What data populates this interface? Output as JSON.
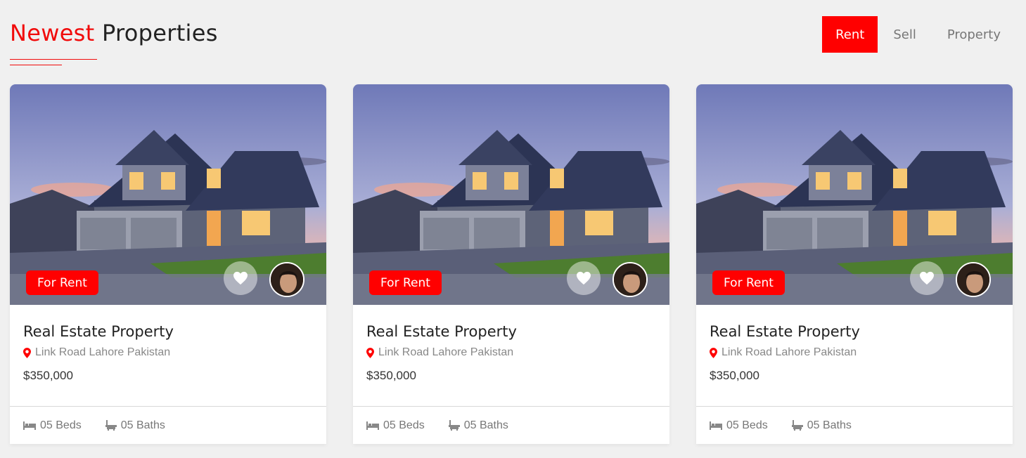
{
  "header": {
    "title_accent": "Newest",
    "title_rest": " Properties",
    "tabs": [
      {
        "label": "Rent",
        "active": true
      },
      {
        "label": "Sell",
        "active": false
      },
      {
        "label": "Property",
        "active": false
      }
    ]
  },
  "colors": {
    "accent": "#ff0000",
    "text": "#222222",
    "muted": "#888888"
  },
  "cards": [
    {
      "badge": "For Rent",
      "title": "Real Estate Property",
      "location": "Link Road Lahore Pakistan",
      "price": "$350,000",
      "beds": "05 Beds",
      "baths": "05 Baths"
    },
    {
      "badge": "For Rent",
      "title": "Real Estate Property",
      "location": "Link Road Lahore Pakistan",
      "price": "$350,000",
      "beds": "05 Beds",
      "baths": "05 Baths"
    },
    {
      "badge": "For Rent",
      "title": "Real Estate Property",
      "location": "Link Road Lahore Pakistan",
      "price": "$350,000",
      "beds": "05 Beds",
      "baths": "05 Baths"
    }
  ],
  "icons": {
    "location": "map-marker-icon",
    "beds": "bed-icon",
    "baths": "bathtub-icon",
    "favorite": "heart-icon"
  }
}
